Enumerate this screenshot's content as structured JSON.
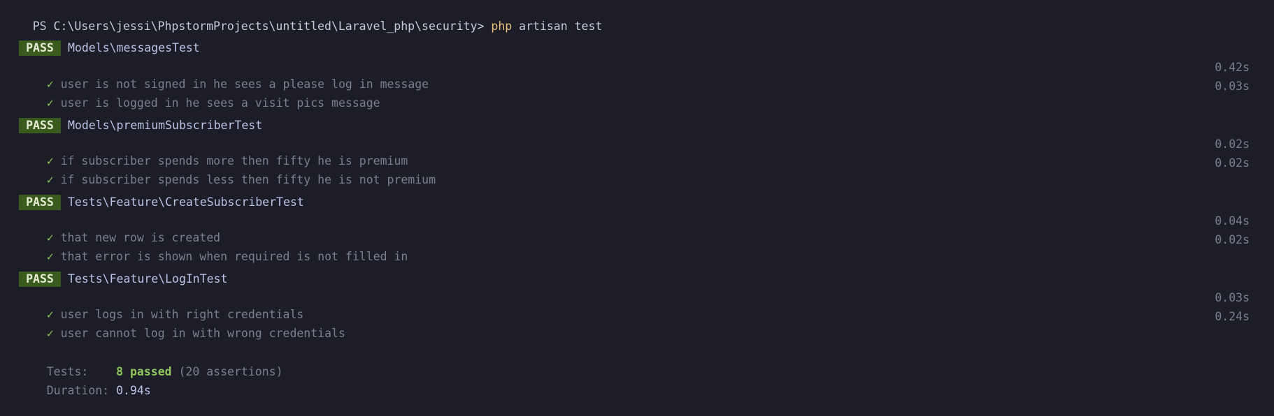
{
  "prompt": {
    "path": "PS C:\\Users\\jessi\\PhpstormProjects\\untitled\\Laravel_php\\security> ",
    "command": "php",
    "args": " artisan test"
  },
  "suites": [
    {
      "badge": "PASS",
      "name": "Models\\messagesTest",
      "tests": [
        {
          "check": "✓",
          "name": "user is not signed in he sees a please log in message",
          "time": "0.42s"
        },
        {
          "check": "✓",
          "name": "user is logged in he sees a visit pics message",
          "time": "0.03s"
        }
      ]
    },
    {
      "badge": "PASS",
      "name": "Models\\premiumSubscriberTest",
      "tests": [
        {
          "check": "✓",
          "name": "if subscriber spends more then fifty he is premium",
          "time": "0.02s"
        },
        {
          "check": "✓",
          "name": "if subscriber spends less then fifty he is not premium",
          "time": "0.02s"
        }
      ]
    },
    {
      "badge": "PASS",
      "name": "Tests\\Feature\\CreateSubscriberTest",
      "tests": [
        {
          "check": "✓",
          "name": "that new row is created",
          "time": "0.04s"
        },
        {
          "check": "✓",
          "name": "that error is shown when required is not filled in",
          "time": "0.02s"
        }
      ]
    },
    {
      "badge": "PASS",
      "name": "Tests\\Feature\\LogInTest",
      "tests": [
        {
          "check": "✓",
          "name": "user logs in with right credentials",
          "time": "0.03s"
        },
        {
          "check": "✓",
          "name": "user cannot log in with wrong credentials",
          "time": "0.24s"
        }
      ]
    }
  ],
  "summary": {
    "tests_label": "Tests:    ",
    "passed": "8 passed",
    "assertions": " (20 assertions)",
    "duration_label": "Duration: ",
    "duration": "0.94s"
  },
  "colors": {
    "background": "#1c1d26",
    "pass_badge": "#3b5a1e",
    "check": "#8fc45c",
    "command": "#e5c07b"
  }
}
